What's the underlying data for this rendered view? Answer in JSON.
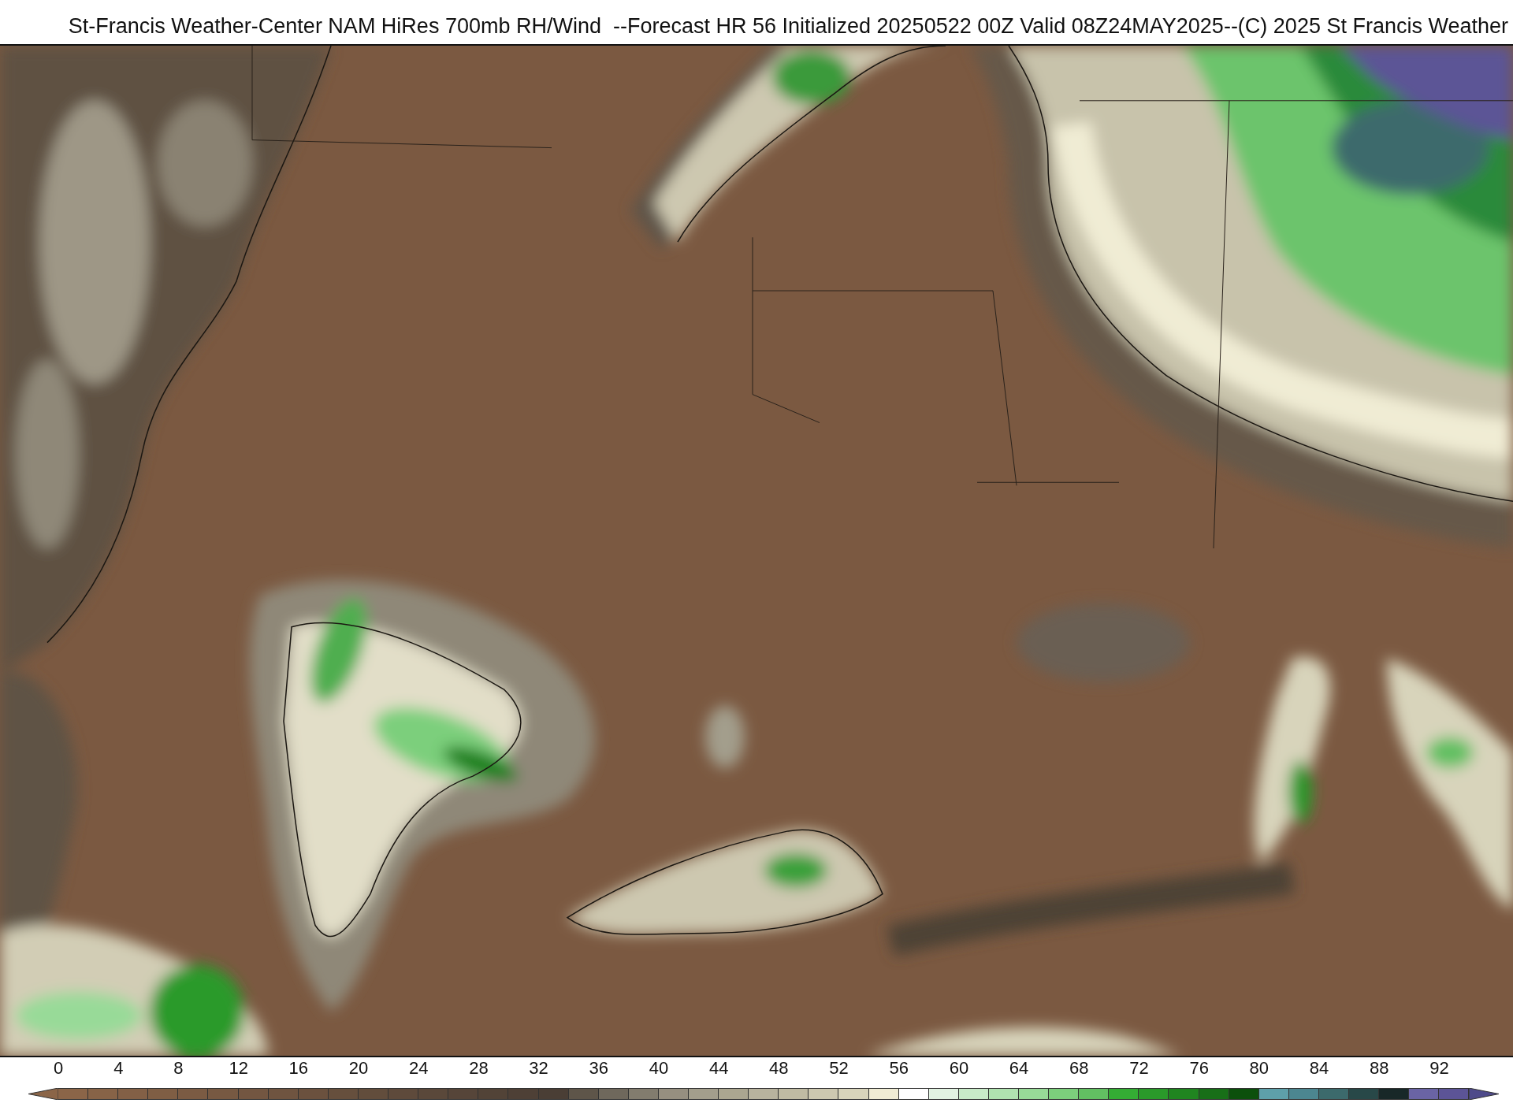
{
  "title": "St-Francis Weather-Center NAM HiRes 700mb RH/Wind  --Forecast HR 56 Initialized 20250522 00Z Valid 08Z24MAY2025--(C) 2025 St Francis Weather",
  "colorbar": {
    "labels": [
      "0",
      "4",
      "8",
      "12",
      "16",
      "20",
      "24",
      "28",
      "32",
      "36",
      "40",
      "44",
      "48",
      "52",
      "56",
      "60",
      "64",
      "68",
      "72",
      "76",
      "80",
      "84",
      "88",
      "92"
    ],
    "under_arrow": {
      "color": "#8b6548"
    },
    "segments": [
      {
        "color": "#8b6548"
      },
      {
        "color": "#876347"
      },
      {
        "color": "#836046"
      },
      {
        "color": "#7f5e44"
      },
      {
        "color": "#7b5b43"
      },
      {
        "color": "#775942"
      },
      {
        "color": "#735641"
      },
      {
        "color": "#6f5440"
      },
      {
        "color": "#6b513e"
      },
      {
        "color": "#664f3d"
      },
      {
        "color": "#624d3c"
      },
      {
        "color": "#5e4a3b"
      },
      {
        "color": "#5a483a"
      },
      {
        "color": "#564539"
      },
      {
        "color": "#524337"
      },
      {
        "color": "#4e4036"
      },
      {
        "color": "#4a3e35"
      },
      {
        "color": "#5e5549"
      },
      {
        "color": "#6f685c"
      },
      {
        "color": "#827c6e"
      },
      {
        "color": "#968f80"
      },
      {
        "color": "#a39e8c"
      },
      {
        "color": "#aba690"
      },
      {
        "color": "#b8b39e"
      },
      {
        "color": "#c0bba3"
      },
      {
        "color": "#cdc8b0"
      },
      {
        "color": "#d8d4bb"
      },
      {
        "color": "#f0ecd4"
      },
      {
        "color": "#ffffff"
      },
      {
        "color": "#e2f3e2"
      },
      {
        "color": "#c8eac8"
      },
      {
        "color": "#b0e2b0"
      },
      {
        "color": "#98da98"
      },
      {
        "color": "#7ccf7c"
      },
      {
        "color": "#62c062"
      },
      {
        "color": "#34ad34"
      },
      {
        "color": "#2a9a2a"
      },
      {
        "color": "#208520"
      },
      {
        "color": "#186f18"
      },
      {
        "color": "#0c500c"
      },
      {
        "color": "#5ea0aa"
      },
      {
        "color": "#4c8690"
      },
      {
        "color": "#3c6a6c"
      },
      {
        "color": "#284848"
      },
      {
        "color": "#182828"
      },
      {
        "color": "#6a64a4"
      },
      {
        "color": "#5c5496"
      }
    ],
    "over_arrow": {
      "color": "#4e4a8a"
    }
  }
}
